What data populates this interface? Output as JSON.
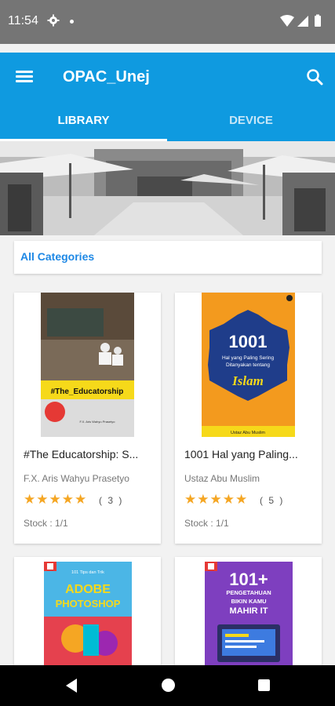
{
  "status_bar": {
    "time": "11:54",
    "icons": [
      "gear-icon",
      "notification-dot",
      "wifi-icon",
      "signal-icon",
      "battery-icon"
    ]
  },
  "app_bar": {
    "title": "OPAC_Unej",
    "menu_icon": "hamburger-menu-icon",
    "search_icon": "search-icon"
  },
  "tabs": [
    {
      "label": "LIBRARY",
      "selected": true
    },
    {
      "label": "DEVICE",
      "selected": false
    }
  ],
  "categories": {
    "label": "All Categories"
  },
  "books": [
    {
      "title": "#The Educatorship: S...",
      "author": "F.X. Aris Wahyu Prasetyo",
      "stars": "★★★★★",
      "rating_count": "( 3 )",
      "stock": "Stock : 1/1",
      "cover_text": [
        "#The_Educatorship",
        "F.X. Aris Wahyu Prasetyo"
      ]
    },
    {
      "title": "1001 Hal yang Paling...",
      "author": "Ustaz Abu Muslim",
      "stars": "★★★★★",
      "rating_count": "( 5 )",
      "stock": "Stock : 1/1",
      "cover_text": [
        "1001",
        "Hal yang Paling Sering Ditanyakan tentang",
        "Islam",
        "Ustaz Abu Muslim"
      ]
    },
    {
      "cover_text": [
        "101 Tips dan Trik",
        "ADOBE PHOTOSHOP"
      ]
    },
    {
      "cover_text": [
        "101+",
        "PENGETAHUAN BIKIN KAMU MAHIR IT"
      ]
    }
  ],
  "colors": {
    "primary": "#0f9ae0",
    "status_bar": "#757575",
    "accent": "#1e88e5",
    "star": "#f5a623"
  },
  "nav_bar": {
    "icons": [
      "back-icon",
      "home-icon",
      "recents-icon"
    ]
  }
}
